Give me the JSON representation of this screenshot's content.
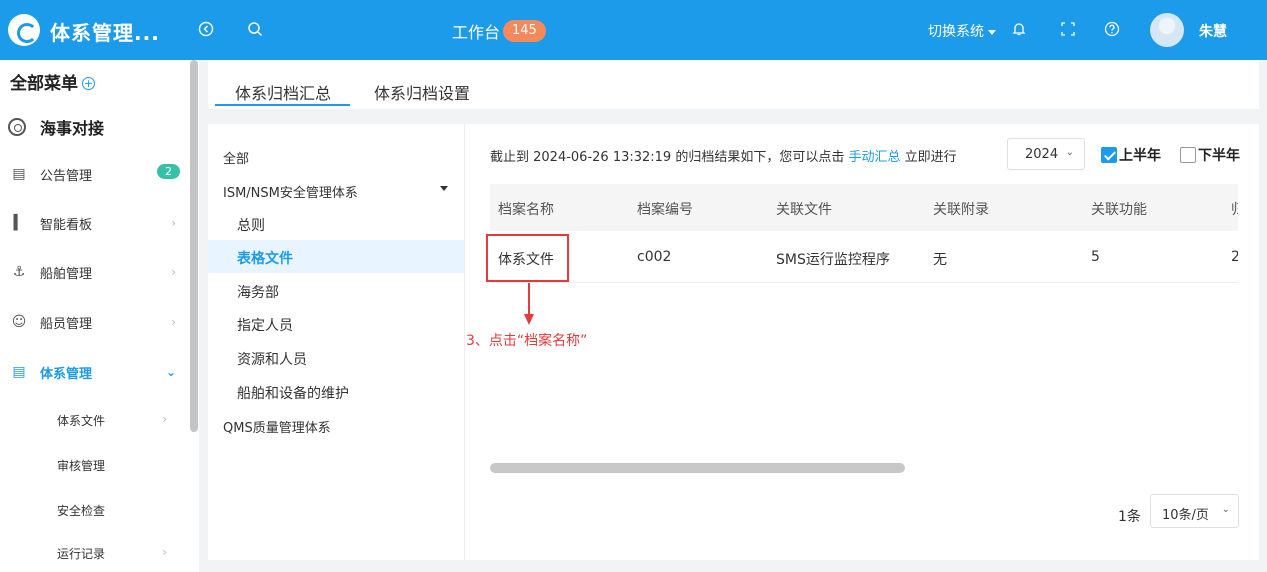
{
  "header": {
    "app_title": "体系管理...",
    "workbench_label": "工作台",
    "workbench_count": "145",
    "switch_system": "切换系统",
    "username": "朱慧"
  },
  "sidebar": {
    "title": "全部菜单",
    "group": "海事对接",
    "items": [
      {
        "label": "公告管理",
        "icon": "bulletin-icon",
        "badge": "2"
      },
      {
        "label": "智能看板",
        "icon": "chart-icon"
      },
      {
        "label": "船舶管理",
        "icon": "anchor-icon"
      },
      {
        "label": "船员管理",
        "icon": "person-icon"
      },
      {
        "label": "体系管理",
        "icon": "document-icon",
        "active": true
      }
    ],
    "subitems": [
      "体系文件",
      "审核管理",
      "安全检查",
      "运行记录"
    ]
  },
  "tabs": [
    "体系归档汇总",
    "体系归档设置"
  ],
  "tree": {
    "all": "全部",
    "ism": "ISM/NSM安全管理体系",
    "children": [
      "总则",
      "表格文件",
      "海务部",
      "指定人员",
      "资源和人员",
      "船舶和设备的维护"
    ],
    "qms": "QMS质量管理体系"
  },
  "summary": {
    "prefix": "截止到 2024-06-26 13:32:19 的归档结果如下，您可以点击",
    "link": "手动汇总",
    "suffix": "立即进行"
  },
  "filters": {
    "year": "2024",
    "first_half": "上半年",
    "second_half": "下半年"
  },
  "table": {
    "headers": [
      "档案名称",
      "档案编号",
      "关联文件",
      "关联附录",
      "关联功能",
      "归"
    ],
    "row": [
      "体系文件",
      "c002",
      "SMS运行监控程序",
      "无",
      "5",
      "2"
    ]
  },
  "annotation": "3、点击“档案名称”",
  "pagination": {
    "total": "1条",
    "page_size": "10条/页"
  },
  "colors": {
    "header_bg": "#1c9bea",
    "accent": "#1c9bea",
    "annotation": "#e23b3b",
    "badge_orange": "#f48a5b",
    "badge_green": "#37c2a8"
  }
}
